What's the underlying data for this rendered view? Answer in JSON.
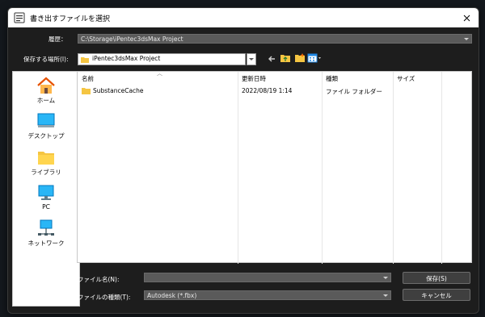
{
  "dialog": {
    "title": "書き出すファイルを選択",
    "close_label": "✕"
  },
  "history": {
    "label": "履歴：",
    "value": "C:\\Storage\\iPentec3dsMax Project"
  },
  "location": {
    "label": "保存する場所(I):",
    "value": "iPentec3dsMax Project"
  },
  "places": [
    {
      "label": "ホーム",
      "icon": "home-icon"
    },
    {
      "label": "デスクトップ",
      "icon": "desktop-icon"
    },
    {
      "label": "ライブラリ",
      "icon": "library-icon"
    },
    {
      "label": "PC",
      "icon": "pc-icon"
    },
    {
      "label": "ネットワーク",
      "icon": "network-icon"
    }
  ],
  "file_list": {
    "columns": [
      "名前",
      "更新日時",
      "種類",
      "サイズ"
    ],
    "rows": [
      {
        "name": "SubstanceCache",
        "modified": "2022/08/19 1:14",
        "type": "ファイル フォルダー",
        "size": ""
      }
    ]
  },
  "filename": {
    "label": "ファイル名(N):",
    "value": ""
  },
  "filetype": {
    "label": "ファイルの種類(T):",
    "value": "Autodesk (*.fbx)"
  },
  "buttons": {
    "save": "保存(S)",
    "cancel": "キャンセル"
  },
  "colors": {
    "dialog_bg": "#1d1d1d",
    "folder_yellow": "#f5c542",
    "accent_blue": "#1e88e5"
  }
}
